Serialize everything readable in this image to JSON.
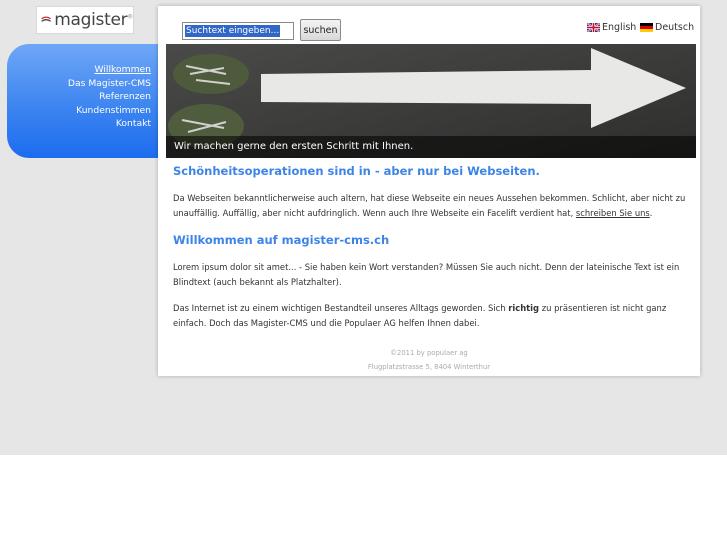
{
  "brand": {
    "logo_text": "magister",
    "logo_mark": "®"
  },
  "nav": {
    "items": [
      {
        "label": "Willkommen",
        "active": true
      },
      {
        "label": "Das Magister-CMS",
        "active": false
      },
      {
        "label": "Referenzen",
        "active": false
      },
      {
        "label": "Kundenstimmen",
        "active": false
      },
      {
        "label": "Kontakt",
        "active": false
      }
    ]
  },
  "search": {
    "value": "Suchtext eingeben...",
    "button_label": "suchen"
  },
  "languages": [
    {
      "label": "English",
      "icon": "flag-uk-icon"
    },
    {
      "label": "Deutsch",
      "icon": "flag-de-icon"
    }
  ],
  "hero": {
    "caption": "Wir machen gerne den ersten Schritt mit Ihnen."
  },
  "section1": {
    "title": "Schönheitsoperationen sind in - aber nur bei Webseiten.",
    "text_before": "Da Webseiten bekanntlicherweise auch altern, hat diese Webseite ein neues Aussehen bekommen. Schlicht, aber nicht zu unauffällig. Auffällig, aber nicht aufdringlich. Wenn auch Ihre Webseite ein Facelift verdient hat, ",
    "link": "schreiben Sie uns",
    "text_after": "."
  },
  "section2": {
    "title": "Willkommen auf magister-cms.ch",
    "para1": "Lorem ipsum dolor sit amet... - Sie haben kein Wort verstanden? Müssen Sie auch nicht. Denn der lateinische Text ist ein Blindtext (auch bekannt als Platzhalter).",
    "para2_before": "Das Internet ist zu einem wichtigen Bestandteil unseres Alltags geworden. Sich ",
    "para2_bold": "richtig",
    "para2_after": " zu präsentieren ist nicht ganz einfach. Doch das Magister-CMS und die Populaer AG helfen Ihnen dabei."
  },
  "footer": {
    "line1": "©2011 by populaer ag",
    "line2": "Flugplatzstrasse 5, 8404 Winterthur"
  },
  "colors": {
    "accent": "#3d84e8",
    "sidebar": "#3d85f0"
  }
}
